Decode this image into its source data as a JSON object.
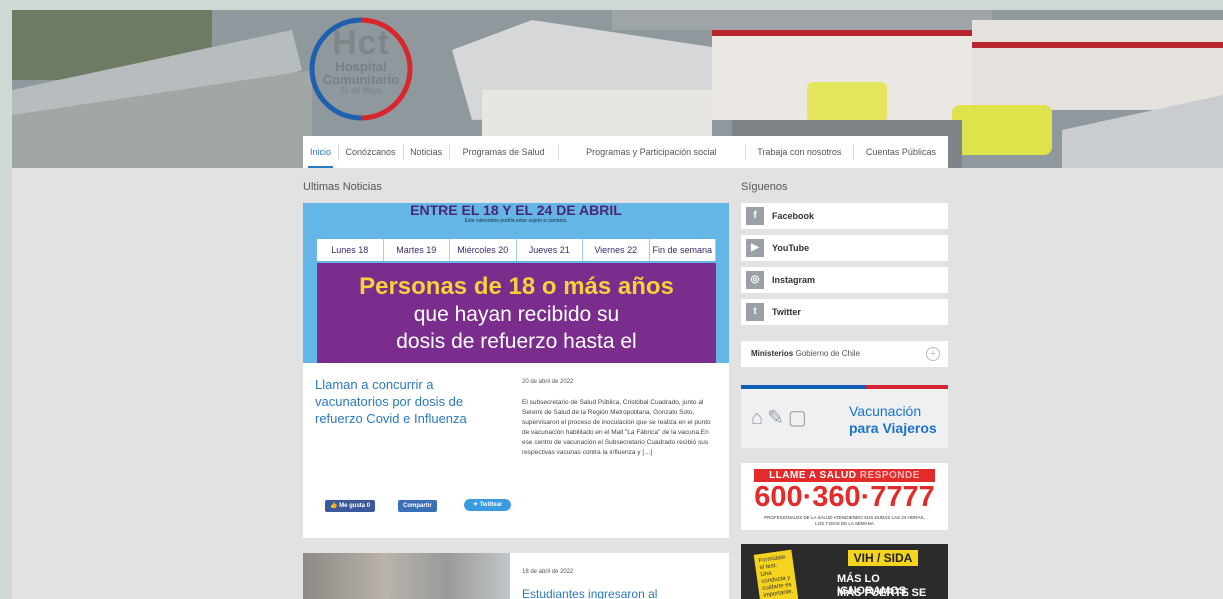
{
  "logo": {
    "line1": "Hct",
    "line2": "Hospital",
    "line3": "Comunitario",
    "line4": "21 de Mayo"
  },
  "nav": [
    "Inicio",
    "Conózcanos",
    "Noticias",
    "Programas de Salud",
    "Programas y Participación social",
    "Trabaja con nosotros",
    "Cuentas Públicas"
  ],
  "sections": {
    "news": "Ultimas Noticias",
    "follow": "Síguenos"
  },
  "news1": {
    "image_header": "ENTRE EL 18 Y EL 24 DE ABRIL",
    "image_sub": "Este calendario podría estar sujeto a cambios.",
    "days": [
      "Lunes 18",
      "Martes 19",
      "Miércoles 20",
      "Jueves 21",
      "Viernes 22",
      "Fin de semana"
    ],
    "image_line1": "Personas de 18 o más años",
    "image_line2": "que hayan recibido su",
    "image_line3": "dosis de refuerzo hasta el",
    "title": "Llaman a concurrir a vacunatorios por dosis de refuerzo Covid e Influenza",
    "date": "20 de abril de 2022",
    "summary": "El subsecretario de Salud Pública, Cristóbal Cuadrado, junto al Seremi de Salud de la Región Metropolitana, Gonzalo Soto, supervisaron el proceso de inoculación que se realiza en el punto de vacunación habilitado en el Mall \"La Fábrica\" de la vacuna.En ese centro de vacunación el Subsecretario Cuadrado recibió sus respectivas vacunas contra la influenza y […]",
    "like": "Me gusta 0",
    "share": "Compartir",
    "tweet": "Twittear"
  },
  "news2": {
    "date": "18 de abril de 2022",
    "title": "Estudiantes ingresaron al"
  },
  "social": [
    {
      "label": "Facebook",
      "icon": "f"
    },
    {
      "label": "YouTube",
      "icon": "▶"
    },
    {
      "label": "Instagram",
      "icon": "◎"
    },
    {
      "label": "Twitter",
      "icon": "t"
    }
  ],
  "ministerios": {
    "bold": "Ministerios",
    "rest": "Gobierno de Chile"
  },
  "vacunacion": {
    "line1": "Vacunación",
    "line2": "para Viajeros"
  },
  "salud_responde": {
    "head1": "LLAME A SALUD",
    "head2": "RESPONDE",
    "number": "600·360·7777",
    "foot1": "PROFESIONALES DE LA SALUD ATENDIENDO SUS DUDAS LAS 24 HORAS,",
    "foot2": "LOS 7 DÍAS DE LA SEMANA"
  },
  "vih": {
    "book": "Formúlate el test. Una conducta y cuidarte es importante.",
    "head": "VIH / SIDA",
    "line1": "MÁS LO IGNORAMOS,",
    "line2": "MÁS FUERTE SE HACE."
  },
  "colors": {
    "link": "#2a7ac0",
    "red": "#e32b2b",
    "purple": "#7b2d8e"
  }
}
